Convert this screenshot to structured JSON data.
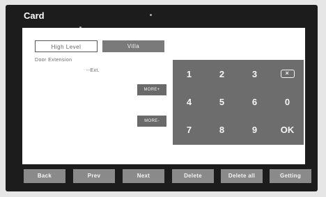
{
  "window": {
    "title": "Card"
  },
  "tabs": {
    "high_level": "High Level",
    "villa": "Villa"
  },
  "fields": {
    "door_extension_label": "Door Extension",
    "extension_value": "--Ext."
  },
  "side_buttons": {
    "upper": "MORE+",
    "lower": "MORE-"
  },
  "keypad": {
    "rows": [
      [
        "1",
        "2",
        "3",
        "⌫"
      ],
      [
        "4",
        "5",
        "6",
        "0"
      ],
      [
        "7",
        "8",
        "9",
        "OK"
      ]
    ]
  },
  "bottom_bar": {
    "buttons": [
      "Back",
      "Prev",
      "Next",
      "Delete",
      "Delete all",
      "Getting"
    ]
  }
}
